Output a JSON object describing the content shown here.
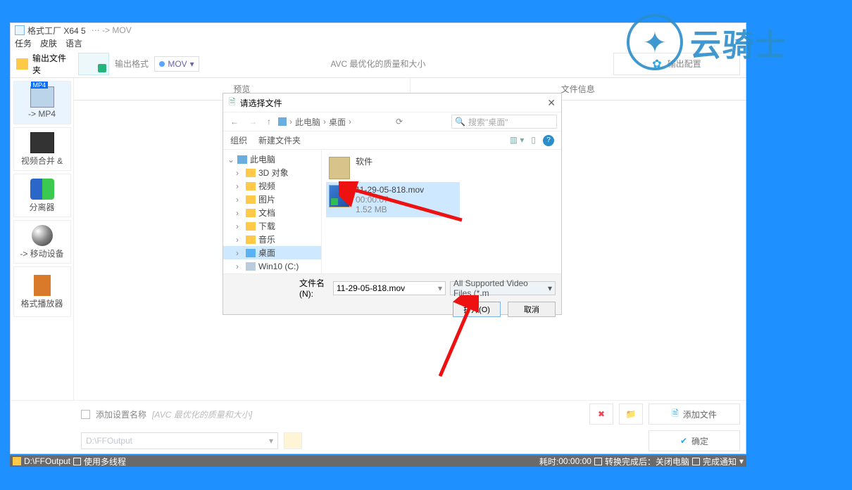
{
  "window": {
    "title": "格式工厂 X64 5",
    "title_extra": "⋯ -> MOV",
    "menu": {
      "task": "任务",
      "skin": "皮肤",
      "lang": "语言"
    }
  },
  "topbar": {
    "output_folder": "输出文件夹",
    "output_format_label": "输出格式",
    "format_selected": "MOV",
    "center_title": "AVC 最优化的质量和大小",
    "settings_btn": "输出配置"
  },
  "tabs": {
    "preview": "预览",
    "fileinfo": "文件信息"
  },
  "tools": {
    "mp4": "-> MP4",
    "merge": "视频合并 &",
    "splitter": "分离器",
    "device": "-> 移动设备",
    "player": "格式播放器"
  },
  "bottom": {
    "checkbox_label": "添加设置名称",
    "checkbox_value": "[AVC 最优化的质量和大小]",
    "add_file": "添加文件",
    "ok": "确定",
    "output_path": "D:\\FFOutput"
  },
  "status": {
    "path": "D:\\FFOutput",
    "multithread": "使用多线程",
    "elapsed_label": "耗时:",
    "elapsed": "00:00:00",
    "after_done": "转换完成后：关闭电脑",
    "notify": "完成通知"
  },
  "dialog": {
    "title": "请选择文件",
    "crumb_pc": "此电脑",
    "crumb_desktop": "桌面",
    "search_placeholder": "搜索\"桌面\"",
    "organize": "组织",
    "new_folder": "新建文件夹",
    "tree": {
      "pc": "此电脑",
      "d3d": "3D 对象",
      "video": "视频",
      "pictures": "图片",
      "docs": "文档",
      "downloads": "下载",
      "music": "音乐",
      "desktop": "桌面",
      "win10": "Win10 (C:)"
    },
    "items": {
      "folder1": "软件",
      "file1_name": "11-29-05-818.mov",
      "file1_dur": "00:00:07",
      "file1_size": "1.52 MB"
    },
    "filename_label": "文件名(N):",
    "filename_value": "11-29-05-818.mov",
    "filter": "All Supported Video Files (*.m",
    "open": "打开(O)",
    "cancel": "取消"
  },
  "watermark": "云骑士"
}
